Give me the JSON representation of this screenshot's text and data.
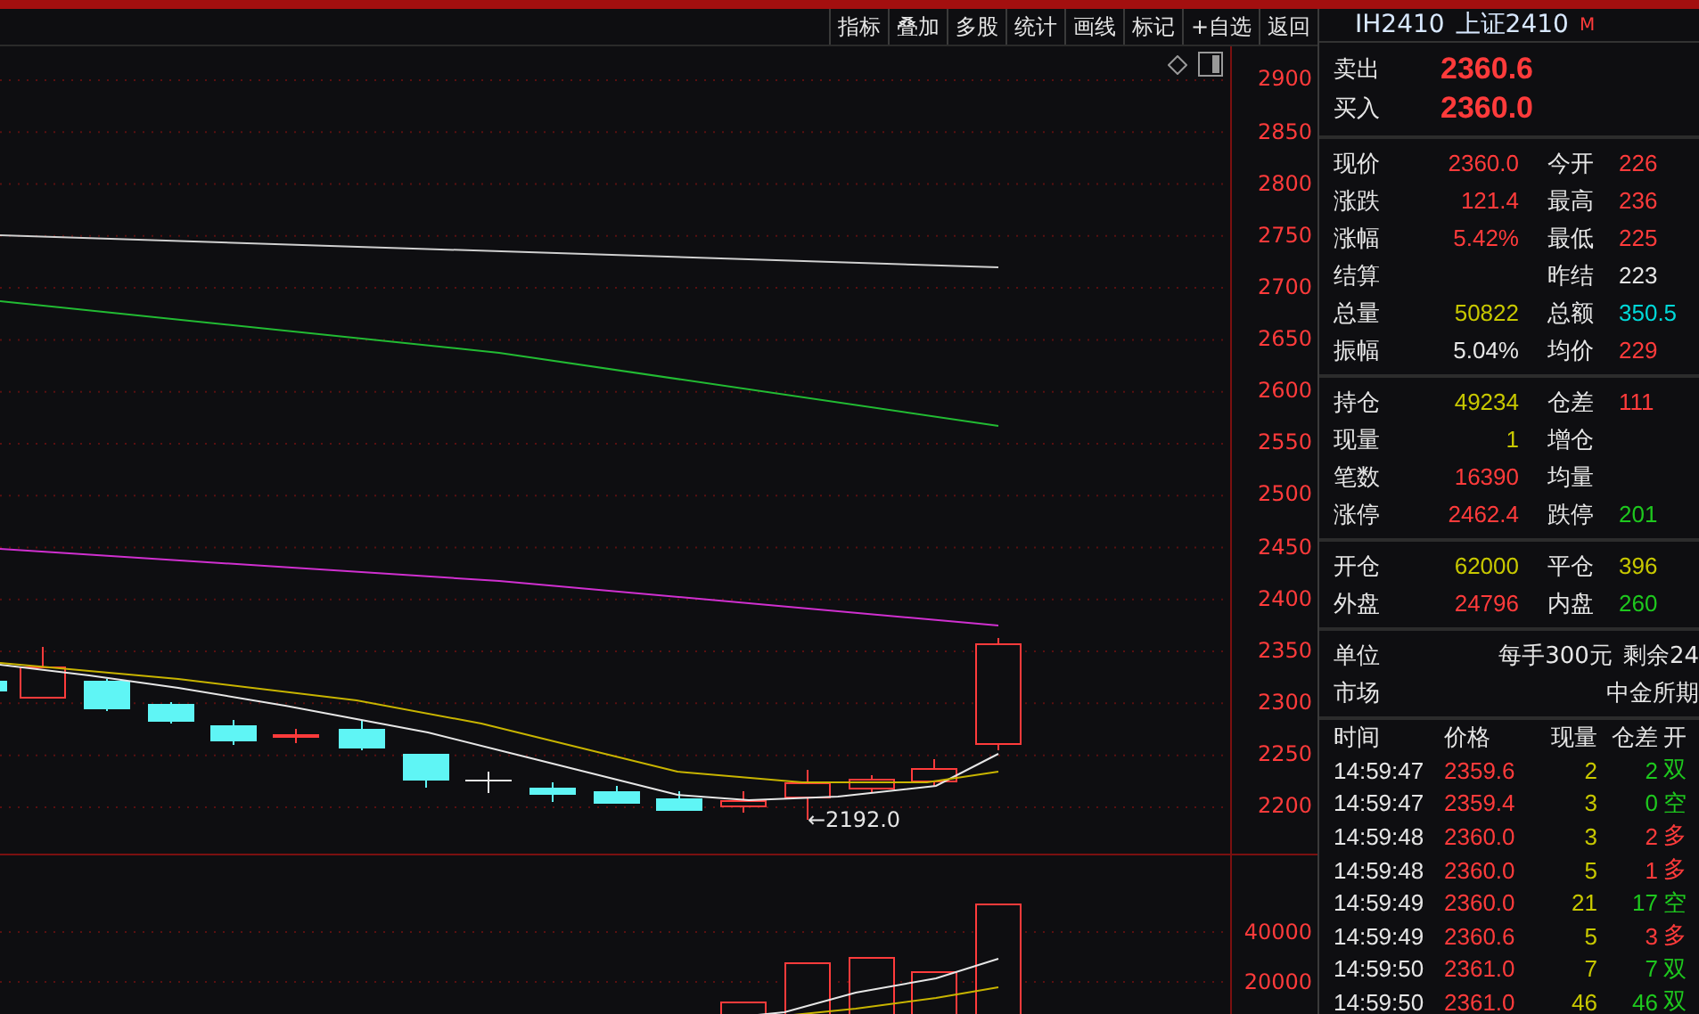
{
  "toolbar": {
    "buttons": [
      "指标",
      "叠加",
      "多股",
      "统计",
      "画线",
      "标记",
      "+自选",
      "返回"
    ]
  },
  "chart": {
    "price_axis": [
      "2900",
      "2850",
      "2800",
      "2750",
      "2700",
      "2650",
      "2600",
      "2550",
      "2500",
      "2450",
      "2400",
      "2350",
      "2300",
      "2250",
      "2200"
    ],
    "low_marker": "←2192.0",
    "volume_axis": [
      "40000",
      "20000"
    ]
  },
  "instrument": {
    "code": "IH2410",
    "name": "上证2410",
    "badge": "M"
  },
  "quote": [
    {
      "label": "卖出",
      "value": "2360.6"
    },
    {
      "label": "买入",
      "value": "2360.0"
    }
  ],
  "stat_sections": [
    {
      "rows": [
        {
          "cells": [
            {
              "label": "现价",
              "value": "2360.0",
              "color": "#ff3b3b"
            },
            {
              "label": "今开",
              "value": "226",
              "color": "#ff3b3b"
            }
          ]
        },
        {
          "cells": [
            {
              "label": "涨跌",
              "value": "121.4",
              "color": "#ff3b3b"
            },
            {
              "label": "最高",
              "value": "236",
              "color": "#ff3b3b"
            }
          ]
        },
        {
          "cells": [
            {
              "label": "涨幅",
              "value": "5.42%",
              "color": "#ff3b3b"
            },
            {
              "label": "最低",
              "value": "225",
              "color": "#ff3b3b"
            }
          ]
        },
        {
          "cells": [
            {
              "label": "结算"
            },
            {
              "label": "昨结",
              "value": "223",
              "color": "#e6e6e6"
            }
          ]
        },
        {
          "cells": [
            {
              "label": "总量",
              "value": "50822",
              "color": "#c8c800"
            },
            {
              "label": "总额",
              "value": "350.5",
              "color": "#00d8d8"
            }
          ]
        },
        {
          "cells": [
            {
              "label": "振幅",
              "value": "5.04%",
              "color": "#e6e6e6"
            },
            {
              "label": "均价",
              "value": "229",
              "color": "#ff3b3b"
            }
          ]
        }
      ]
    },
    {
      "rows": [
        {
          "cells": [
            {
              "label": "持仓",
              "value": "49234",
              "color": "#c8c800"
            },
            {
              "label": "仓差",
              "value": "111",
              "color": "#ff3b3b"
            }
          ]
        },
        {
          "cells": [
            {
              "label": "现量",
              "value": "1",
              "color": "#c8c800"
            },
            {
              "label": "增仓"
            }
          ]
        },
        {
          "cells": [
            {
              "label": "笔数",
              "value": "16390",
              "color": "#ff3b3b"
            },
            {
              "label": "均量"
            }
          ]
        },
        {
          "cells": [
            {
              "label": "涨停",
              "value": "2462.4",
              "color": "#ff3b3b"
            },
            {
              "label": "跌停",
              "value": "201",
              "color": "#1ec81e"
            }
          ]
        }
      ]
    },
    {
      "rows": [
        {
          "cells": [
            {
              "label": "开仓",
              "value": "62000",
              "color": "#c8c800"
            },
            {
              "label": "平仓",
              "value": "396",
              "color": "#c8c800"
            }
          ]
        },
        {
          "cells": [
            {
              "label": "外盘",
              "value": "24796",
              "color": "#ff3b3b"
            },
            {
              "label": "内盘",
              "value": "260",
              "color": "#1ec81e"
            }
          ]
        }
      ]
    }
  ],
  "info": [
    {
      "label": "单位",
      "values": [
        "每手300元",
        "剩余24"
      ]
    },
    {
      "label": "市场",
      "values": [
        "中金所期"
      ]
    }
  ],
  "trades": {
    "columns": [
      "时间",
      "价格",
      "现量",
      "仓差",
      "开"
    ],
    "rows": [
      {
        "time": "14:59:47",
        "price": "2359.6",
        "volume": "2",
        "change": "2",
        "type": "双",
        "color": "#1ec81e"
      },
      {
        "time": "14:59:47",
        "price": "2359.4",
        "volume": "3",
        "change": "0",
        "type": "空",
        "color": "#1ec81e"
      },
      {
        "time": "14:59:48",
        "price": "2360.0",
        "volume": "3",
        "change": "2",
        "type": "多",
        "color": "#ff3b3b"
      },
      {
        "time": "14:59:48",
        "price": "2360.0",
        "volume": "5",
        "change": "1",
        "type": "多",
        "color": "#ff3b3b"
      },
      {
        "time": "14:59:49",
        "price": "2360.0",
        "volume": "21",
        "change": "17",
        "type": "空",
        "color": "#1ec81e"
      },
      {
        "time": "14:59:49",
        "price": "2360.6",
        "volume": "5",
        "change": "3",
        "type": "多",
        "color": "#ff3b3b"
      },
      {
        "time": "14:59:50",
        "price": "2361.0",
        "volume": "7",
        "change": "7",
        "type": "双",
        "color": "#1ec81e"
      },
      {
        "time": "14:59:50",
        "price": "2361.0",
        "volume": "46",
        "change": "46",
        "type": "双",
        "color": "#1ec81e"
      }
    ]
  }
}
